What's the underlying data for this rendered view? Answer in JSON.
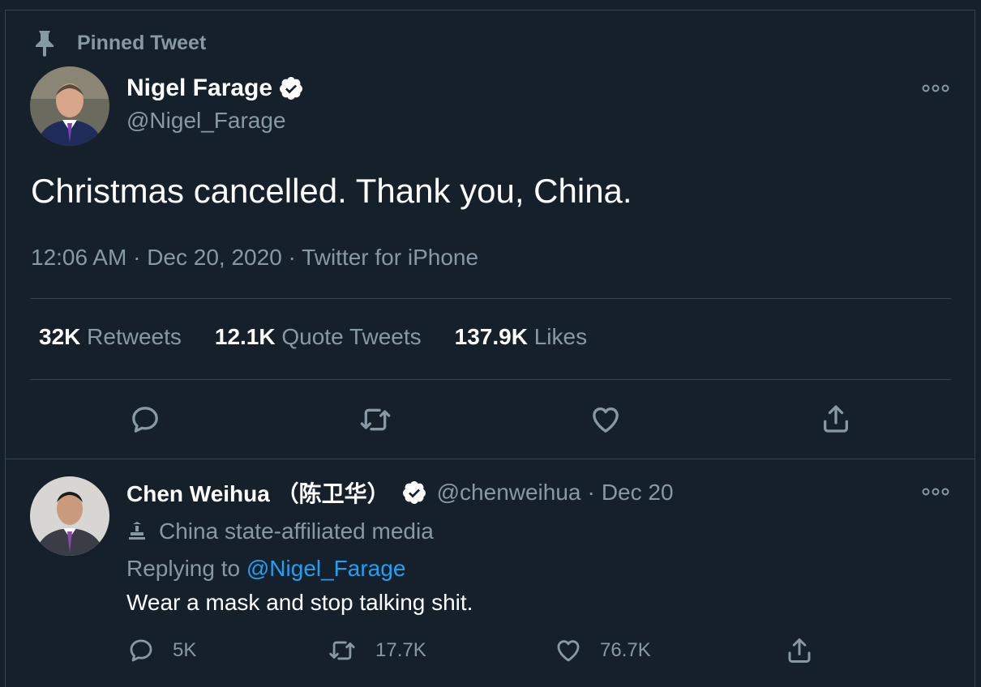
{
  "pinned": {
    "label": "Pinned Tweet",
    "icon": "pin-icon"
  },
  "tweet": {
    "author": {
      "name": "Nigel Farage",
      "handle": "@Nigel_Farage",
      "verified": true
    },
    "text": "Christmas cancelled. Thank you, China.",
    "time": "12:06 AM",
    "date": "Dec 20, 2020",
    "source": "Twitter for iPhone",
    "stats": [
      {
        "count": "32K",
        "label": "Retweets"
      },
      {
        "count": "12.1K",
        "label": "Quote Tweets"
      },
      {
        "count": "137.9K",
        "label": "Likes"
      }
    ]
  },
  "reply": {
    "author": {
      "name": "Chen Weihua （陈卫华）",
      "handle": "@chenweihua",
      "verified": true
    },
    "date": "Dec 20",
    "affiliation": "China state-affiliated media",
    "replying_prefix": "Replying to",
    "replying_handle": "@Nigel_Farage",
    "text": "Wear a mask and stop talking shit.",
    "counts": {
      "replies": "5K",
      "retweets": "17.7K",
      "likes": "76.7K"
    }
  },
  "colors": {
    "background": "#15202b",
    "border": "#38444d",
    "muted": "#8899a6",
    "link": "#1da1f2",
    "text": "#ffffff"
  }
}
